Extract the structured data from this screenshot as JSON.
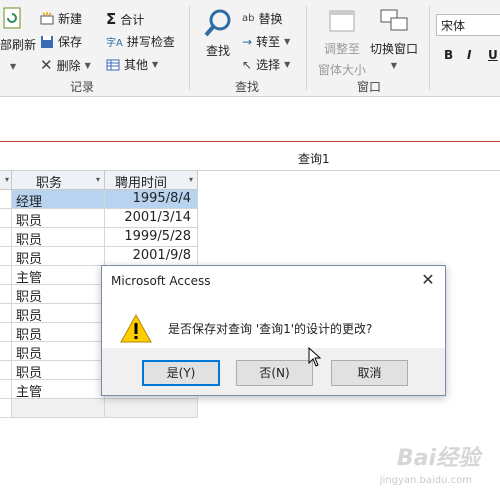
{
  "ribbon": {
    "refresh_label": "部刷新",
    "new_label": "新建",
    "save_label": "保存",
    "delete_label": "删除",
    "totals_label": "合计",
    "spell_label": "拼写检查",
    "other_label": "其他",
    "records_group": "记录",
    "find_label": "查找",
    "replace_label": "替换",
    "goto_label": "转至",
    "select_label": "选择",
    "find_group": "查找",
    "fit_label_1": "调整至",
    "fit_label_2": "窗体大小",
    "switch_label": "切换窗口",
    "window_group": "窗口",
    "font_name": "宋体",
    "bold": "B",
    "italic": "I",
    "underline": "U"
  },
  "tab": {
    "title": "查询1"
  },
  "table": {
    "headers": [
      "职务",
      "聘用时间"
    ],
    "rows": [
      {
        "pos": "经理",
        "date": "1995/8/4",
        "selected": true
      },
      {
        "pos": "职员",
        "date": "2001/3/14"
      },
      {
        "pos": "职员",
        "date": "1999/5/28"
      },
      {
        "pos": "职员",
        "date": "2001/9/8"
      },
      {
        "pos": "主管",
        "date": ""
      },
      {
        "pos": "职员",
        "date": ""
      },
      {
        "pos": "职员",
        "date": ""
      },
      {
        "pos": "职员",
        "date": ""
      },
      {
        "pos": "职员",
        "date": ""
      },
      {
        "pos": "职员",
        "date": ""
      },
      {
        "pos": "主管",
        "date": ""
      }
    ]
  },
  "dialog": {
    "title": "Microsoft Access",
    "message": "是否保存对查询 '查询1'的设计的更改?",
    "yes": "是(Y)",
    "no": "否(N)",
    "cancel": "取消"
  },
  "watermark": {
    "text": "Bai经验",
    "sub": "jingyan.baidu.com"
  }
}
